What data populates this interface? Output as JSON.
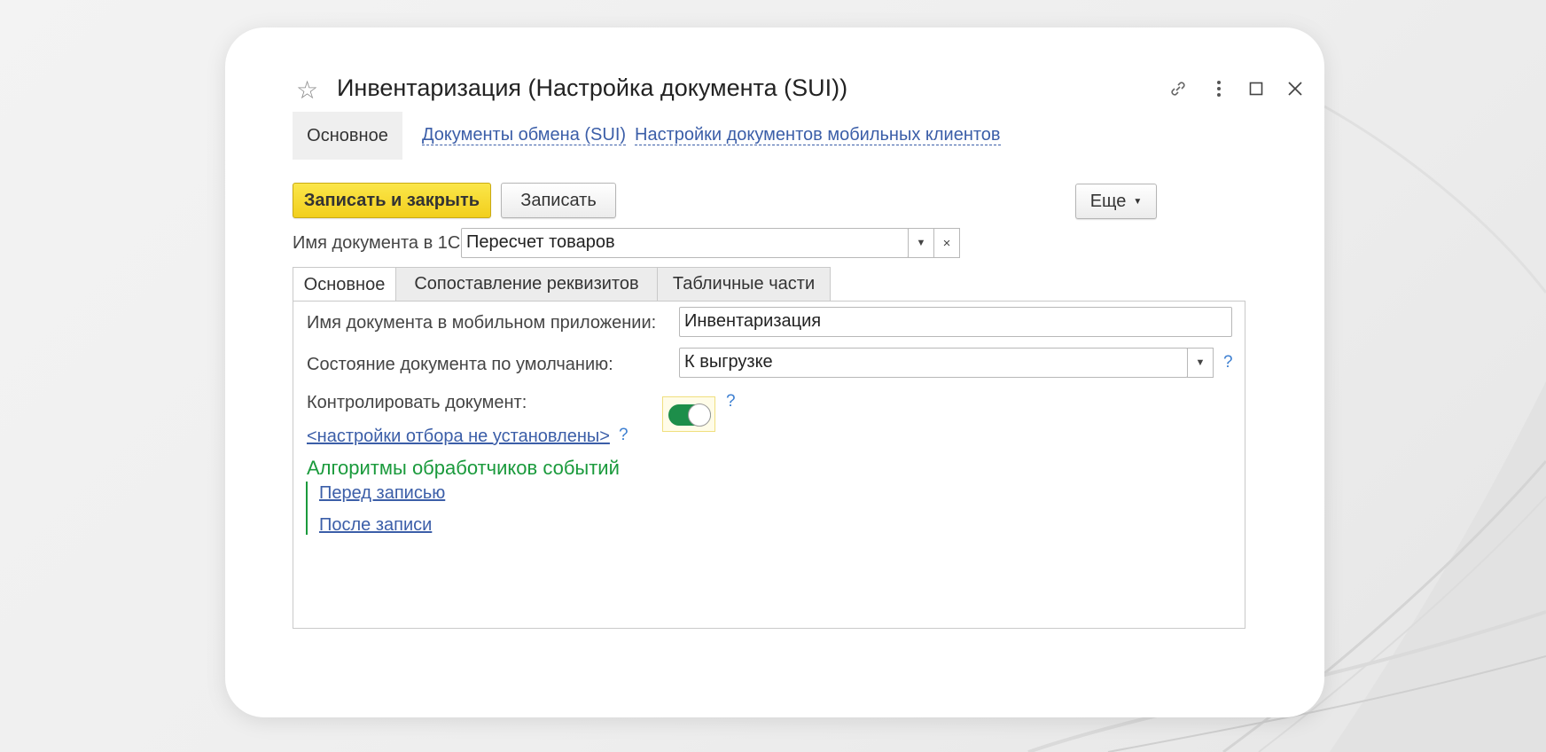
{
  "window": {
    "title": "Инвентаризация (Настройка документа (SUI))"
  },
  "form_tabs": {
    "active": "Основное",
    "links": [
      "Документы обмена (SUI)",
      "Настройки документов мобильных клиентов"
    ]
  },
  "toolbar": {
    "save_close_label": "Записать и закрыть",
    "save_label": "Записать",
    "more_label": "Еще"
  },
  "doc_name_1c": {
    "label": "Имя документа в 1С:",
    "value": "Пересчет товаров"
  },
  "tabs": [
    "Основное",
    "Сопоставление реквизитов",
    "Табличные части"
  ],
  "main": {
    "mobile_name_label": "Имя документа в мобильном приложении:",
    "mobile_name_value": "Инвентаризация",
    "default_state_label": "Состояние документа по умолчанию:",
    "default_state_value": "К выгрузке",
    "control_label": "Контролировать документ:",
    "control_on": true,
    "filter_link": "<настройки отбора не установлены>",
    "help_mark": "?",
    "group_title": "Алгоритмы обработчиков событий",
    "event_links": [
      "Перед записью",
      "После записи"
    ]
  },
  "colors": {
    "accent_yellow": "#f2cf1c",
    "link_blue": "#3b5ea8",
    "group_green": "#1a9a3c",
    "toggle_green": "#1d8e4a"
  },
  "icons": [
    "star-icon",
    "link-icon",
    "more-vert-icon",
    "maximize-icon",
    "close-icon",
    "chevron-down-icon",
    "clear-icon",
    "help-icon"
  ]
}
